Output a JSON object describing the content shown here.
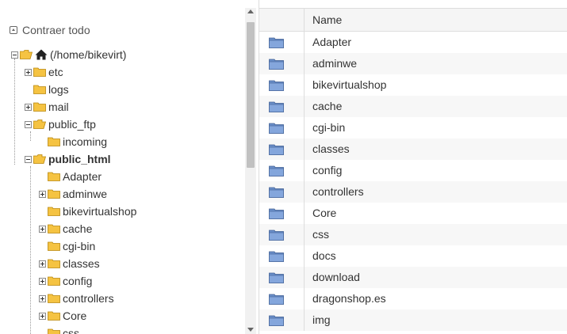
{
  "tree": {
    "collapse_label": "Contraer todo",
    "root_label": "(/home/bikevirt)",
    "items": [
      {
        "label": "etc",
        "toggle": "plus"
      },
      {
        "label": "logs",
        "toggle": "none"
      },
      {
        "label": "mail",
        "toggle": "plus"
      },
      {
        "label": "public_ftp",
        "toggle": "minus"
      },
      {
        "label": "incoming",
        "toggle": "none"
      },
      {
        "label": "public_html",
        "toggle": "minus"
      },
      {
        "label": "Adapter",
        "toggle": "none"
      },
      {
        "label": "adminwe",
        "toggle": "plus"
      },
      {
        "label": "bikevirtualshop",
        "toggle": "none"
      },
      {
        "label": "cache",
        "toggle": "plus"
      },
      {
        "label": "cgi-bin",
        "toggle": "none"
      },
      {
        "label": "classes",
        "toggle": "plus"
      },
      {
        "label": "config",
        "toggle": "plus"
      },
      {
        "label": "controllers",
        "toggle": "plus"
      },
      {
        "label": "Core",
        "toggle": "plus"
      },
      {
        "label": "css",
        "toggle": "none"
      }
    ]
  },
  "table": {
    "header_name": "Name",
    "rows": [
      {
        "name": "Adapter"
      },
      {
        "name": "adminwe"
      },
      {
        "name": "bikevirtualshop"
      },
      {
        "name": "cache"
      },
      {
        "name": "cgi-bin"
      },
      {
        "name": "classes"
      },
      {
        "name": "config"
      },
      {
        "name": "controllers"
      },
      {
        "name": "Core"
      },
      {
        "name": "css"
      },
      {
        "name": "docs"
      },
      {
        "name": "download"
      },
      {
        "name": "dragonshop.es"
      },
      {
        "name": "img"
      }
    ]
  },
  "colors": {
    "folder_yellow": "#f5c342",
    "folder_blue": "#6a8fc9"
  }
}
